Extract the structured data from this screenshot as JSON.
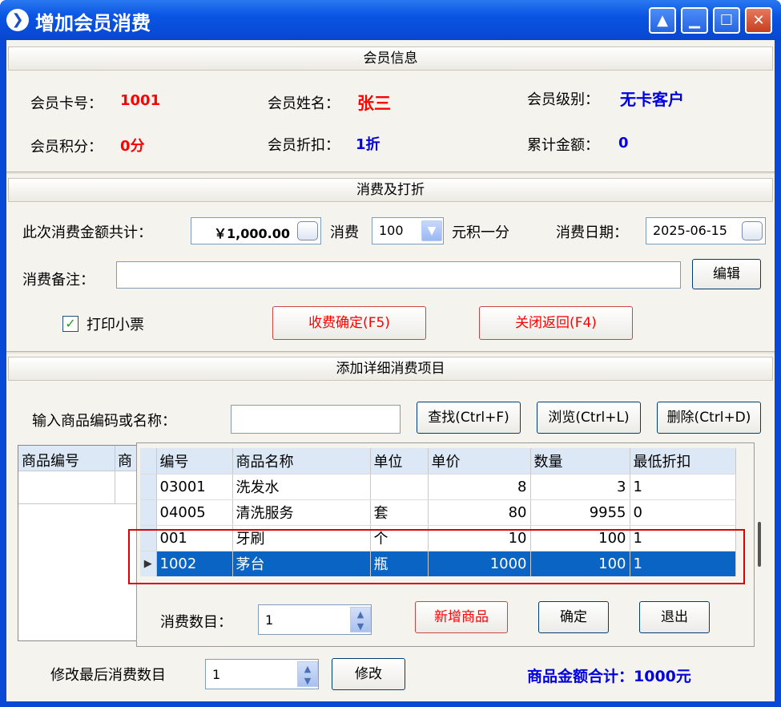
{
  "window": {
    "title": "增加会员消费",
    "controls": {
      "restore": "▲",
      "minimize": "▁",
      "maximize": "☐",
      "close": "✕"
    }
  },
  "member_info": {
    "section_title": "会员信息",
    "card_label": "会员卡号：",
    "card_value": "1001",
    "name_label": "会员姓名：",
    "name_value": "张三",
    "level_label": "会员级别：",
    "level_value": "无卡客户",
    "points_label": "会员积分：",
    "points_value": "0分",
    "discount_label": "会员折扣：",
    "discount_value": "1折",
    "total_label": "累计金额：",
    "total_value": "0"
  },
  "consume": {
    "section_title": "消费及打折",
    "amount_label": "此次消费金额共计：",
    "amount_value": "￥1,000.00",
    "per_label": "消费",
    "per_value": "100",
    "per_suffix": "元积一分",
    "date_label": "消费日期：",
    "date_value": "2025-06-15",
    "note_label": "消费备注：",
    "note_value": "",
    "edit_button": "编辑",
    "print_label": "打印小票",
    "print_checked": true,
    "confirm_button": "收费确定(F5)",
    "close_button": "关闭返回(F4)"
  },
  "detail": {
    "section_title": "添加详细消费项目",
    "search_label": "输入商品编码或名称：",
    "search_value": "",
    "find_button": "查找(Ctrl+F)",
    "browse_button": "浏览(Ctrl+L)",
    "delete_button": "删除(Ctrl+D)",
    "back_headers": [
      "商品编号",
      "商"
    ]
  },
  "popup": {
    "columns": [
      "编号",
      "商品名称",
      "单位",
      "单价",
      "数量",
      "最低折扣"
    ],
    "rows": [
      {
        "code": "03001",
        "name": "洗发水",
        "unit": "",
        "price": "8",
        "qty": "3",
        "min_disc": "1"
      },
      {
        "code": "04005",
        "name": "清洗服务",
        "unit": "套",
        "price": "80",
        "qty": "9955",
        "min_disc": "0"
      },
      {
        "code": "001",
        "name": "牙刷",
        "unit": "个",
        "price": "10",
        "qty": "100",
        "min_disc": "1"
      },
      {
        "code": "1002",
        "name": "茅台",
        "unit": "瓶",
        "price": "1000",
        "qty": "100",
        "min_disc": "1"
      }
    ],
    "selected_index": 3,
    "count_label": "消费数目：",
    "count_value": "1",
    "add_button": "新增商品",
    "ok_button": "确定",
    "exit_button": "退出"
  },
  "footer": {
    "modify_label": "修改最后消费数目",
    "modify_value": "1",
    "modify_button": "修改",
    "total_label": "商品金额合计：1000元"
  },
  "colors": {
    "title_blue": "#0a49d6",
    "highlight_red": "#e00000",
    "selection": "#0a64c4"
  }
}
